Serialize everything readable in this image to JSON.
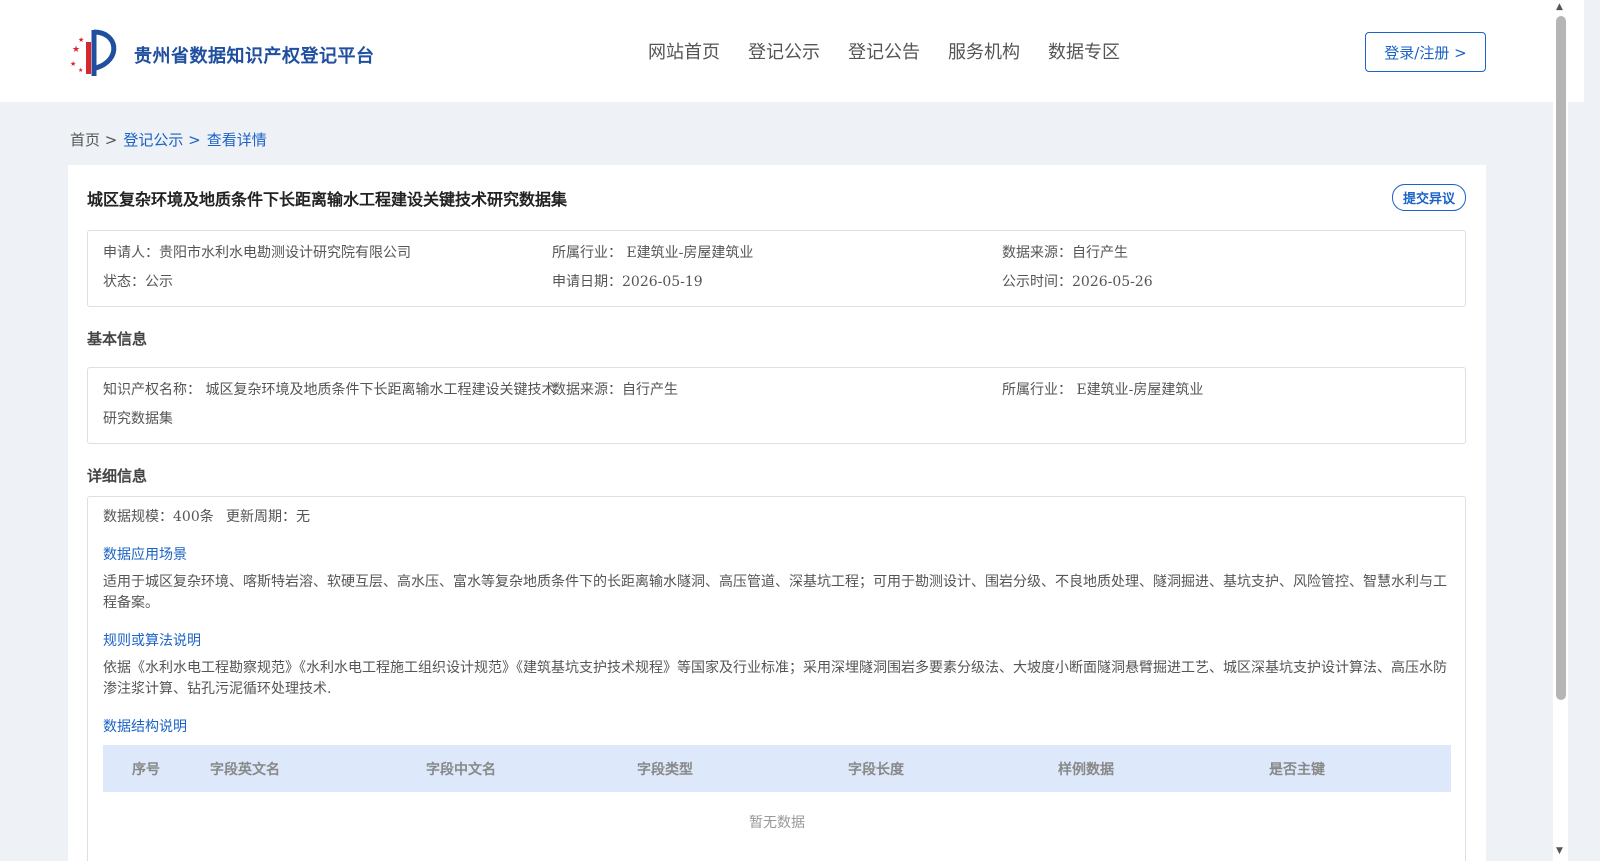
{
  "header": {
    "site_title": "贵州省数据知识产权登记平台",
    "nav": [
      "网站首页",
      "登记公示",
      "登记公告",
      "服务机构",
      "数据专区"
    ],
    "login_label": "登录/注册 >"
  },
  "breadcrumb": {
    "home": "首页 >",
    "section": "登记公示 >",
    "current": "查看详情"
  },
  "detail": {
    "title": "城区复杂环境及地质条件下长距离输水工程建设关键技术研究数据集",
    "objection_label": "提交异议",
    "summary": {
      "applicant": "申请人：贵阳市水利水电勘测设计研究院有限公司",
      "industry": "所属行业： E建筑业-房屋建筑业",
      "source": "数据来源：自行产生",
      "status": "状态：公示",
      "apply_date": "申请日期：2026-05-19",
      "publish_date": "公示时间：2026-05-26"
    },
    "basic_title": "基本信息",
    "basic": {
      "ip_name_line1": "知识产权名称： 城区复杂环境及地质条件下长距离输水工程建设关键技术",
      "ip_name_line2": "研究数据集",
      "source": "数据来源：自行产生",
      "industry": "所属行业： E建筑业-房屋建筑业"
    },
    "detail_title": "详细信息",
    "scale": "数据规模：400条",
    "update_cycle": "更新周期：无",
    "scenario_title": "数据应用场景",
    "scenario_text": "适用于城区复杂环境、喀斯特岩溶、软硬互层、高水压、富水等复杂地质条件下的长距离输水隧洞、高压管道、深基坑工程；可用于勘测设计、围岩分级、不良地质处理、隧洞掘进、基坑支护、风险管控、智慧水利与工程备案。",
    "rules_title": "规则或算法说明",
    "rules_text": "依据《水利水电工程勘察规范》《水利水电工程施工组织设计规范》《建筑基坑支护技术规程》等国家及行业标准；采用深埋隧洞围岩多要素分级法、大坡度小断面隧洞悬臂掘进工艺、城区深基坑支护设计算法、高压水防渗注浆计算、钻孔污泥循环处理技术.",
    "structure_title": "数据结构说明",
    "table_headers": [
      "序号",
      "字段英文名",
      "字段中文名",
      "字段类型",
      "字段长度",
      "样例数据",
      "是否主键"
    ],
    "empty_text": "暂无数据"
  }
}
